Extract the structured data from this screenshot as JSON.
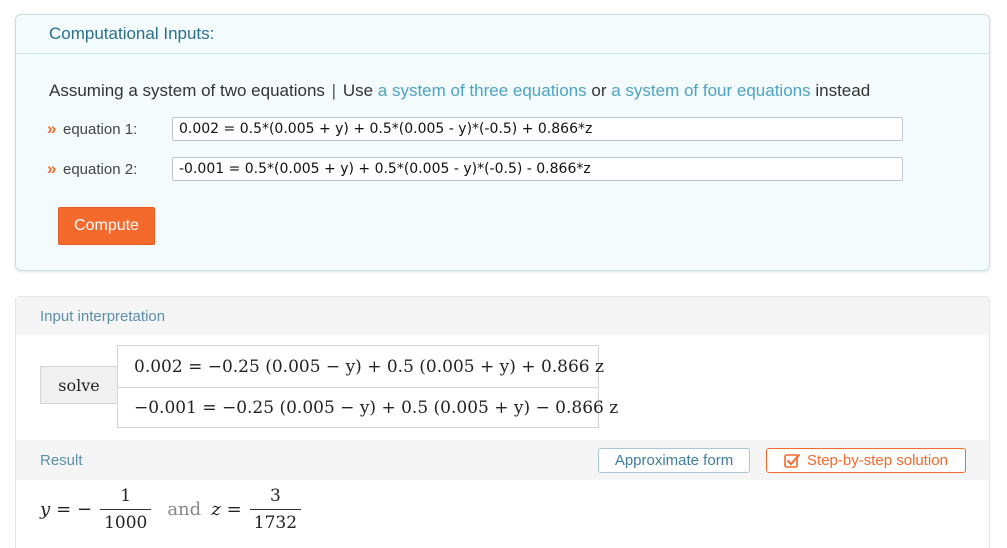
{
  "inputs": {
    "title": "Computational Inputs:",
    "assume_prefix": "Assuming a system of two equations",
    "assume_sep": "|",
    "use_text": "Use",
    "alt_three": "a system of three equations",
    "or_text": "or",
    "alt_four": "a system of four equations",
    "instead_text": "instead",
    "equation1_label": "equation 1:",
    "equation1_value": "0.002 = 0.5*(0.005 + y) + 0.5*(0.005 - y)*(-0.5) + 0.866*z",
    "equation2_label": "equation 2:",
    "equation2_value": "-0.001 = 0.5*(0.005 + y) + 0.5*(0.005 - y)*(-0.5) - 0.866*z",
    "chevron": "»",
    "compute_label": "Compute"
  },
  "interpretation": {
    "title": "Input interpretation",
    "solve_label": "solve",
    "eq1": "0.002 = −0.25 (0.005 − y) + 0.5 (0.005 + y) + 0.866 z",
    "eq2": "−0.001 = −0.25 (0.005 − y) + 0.5 (0.005 + y) − 0.866 z"
  },
  "result": {
    "title": "Result",
    "approx_label": "Approximate form",
    "step_label": "Step-by-step solution",
    "y_var": "y",
    "y_eq": "= −",
    "y_num": "1",
    "y_den": "1000",
    "and_text": "and",
    "z_var": "z",
    "z_eq": "=",
    "z_num": "3",
    "z_den": "1732"
  },
  "colors": {
    "accent_orange": "#f4692c",
    "link_blue": "#4ea3c2",
    "panel_bg": "#f3fbfc"
  }
}
